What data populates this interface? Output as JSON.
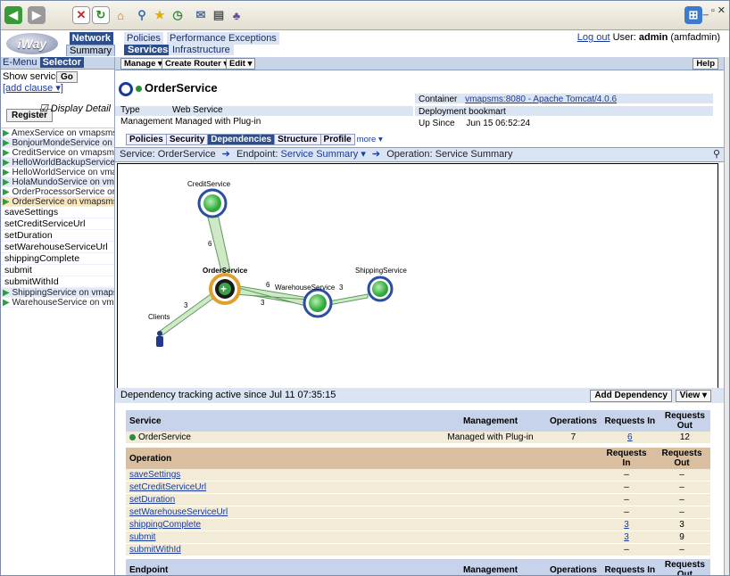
{
  "browser": {
    "controls": "_ ▫ ✕"
  },
  "app": {
    "logo": "iWay",
    "logo_sub": "Software",
    "network": "Network",
    "summary": "Summary",
    "topnav": [
      "Policies",
      "Performance",
      "Exceptions"
    ],
    "subnav": [
      "Services",
      "Infrastructure"
    ],
    "logout": "Log out",
    "user_prefix": "User:",
    "user": "admin",
    "role": "(amfadmin)"
  },
  "left": {
    "emenu": "E-Menu",
    "selector": "Selector",
    "show_services": "Show services",
    "go": "Go",
    "add_clause": "[add clause ▾]",
    "register": "Register",
    "display_detail": "Display Detail",
    "services": [
      "AmexService on vmapsms",
      "BonjourMondeService on v",
      "CreditService on vmapsms",
      "HelloWorldBackupService",
      "HelloWorldService on vma",
      "HolaMundoService on vma",
      "OrderProcessorService or",
      "OrderService on vmapsms"
    ],
    "operations": [
      "saveSettings",
      "setCreditServiceUrl",
      "setDuration",
      "setWarehouseServiceUrl",
      "shippingComplete",
      "submit",
      "submitWithId"
    ],
    "services2": [
      "ShippingService on vmaps",
      "WarehouseService on vm"
    ]
  },
  "toolbar": {
    "manage": "Manage ▾",
    "create_router": "Create Router ▾",
    "edit": "Edit ▾",
    "help": "Help"
  },
  "service": {
    "name": "OrderService",
    "type_label": "Type",
    "type": "Web Service",
    "mgmt_label": "Management",
    "mgmt": "Managed with Plug-in",
    "container_label": "Container",
    "container": "vmapsms:8080 - Apache Tomcat/4.0.6",
    "deploy_label": "Deployment",
    "deploy": "bookmart",
    "upsince_label": "Up Since",
    "upsince": "Jun 15 06:52:24"
  },
  "tabs": [
    "Policies",
    "Security",
    "Dependencies",
    "Structure",
    "Profile"
  ],
  "more": "more ▾",
  "crumb": {
    "service": "Service: OrderService",
    "arrow": "➔",
    "endpoint_label": "Endpoint:",
    "endpoint": "Service Summary ▾",
    "op_label": "Operation:",
    "op": "Service Summary"
  },
  "diagram": {
    "credit": "CreditService",
    "order": "OrderService",
    "warehouse": "WarehouseService",
    "shipping": "ShippingService",
    "clients": "Clients",
    "e_order_credit": "6",
    "e_order_warehouse": "6",
    "e_warehouse_order": "3",
    "e_warehouse_ship": "3",
    "e_clients_order": "3"
  },
  "tracking": {
    "text": "Dependency tracking active since Jul 11 07:35:15",
    "add": "Add Dependency",
    "view": "View ▾"
  },
  "table1": {
    "h": [
      "Service",
      "Management",
      "Operations",
      "Requests In",
      "Requests Out"
    ],
    "row": [
      "OrderService",
      "Managed with Plug-in",
      "7",
      "6",
      "12"
    ]
  },
  "table2": {
    "h": [
      "Operation",
      "Requests In",
      "Requests Out"
    ],
    "rows": [
      [
        "saveSettings",
        "–",
        "–"
      ],
      [
        "setCreditServiceUrl",
        "–",
        "–"
      ],
      [
        "setDuration",
        "–",
        "–"
      ],
      [
        "setWarehouseServiceUrl",
        "–",
        "–"
      ],
      [
        "shippingComplete",
        "3",
        "3"
      ],
      [
        "submit",
        "3",
        "9"
      ],
      [
        "submitWithId",
        "–",
        "–"
      ]
    ]
  },
  "table3": {
    "h": [
      "Endpoint",
      "Management",
      "Operations",
      "Requests In",
      "Requests Out"
    ]
  }
}
